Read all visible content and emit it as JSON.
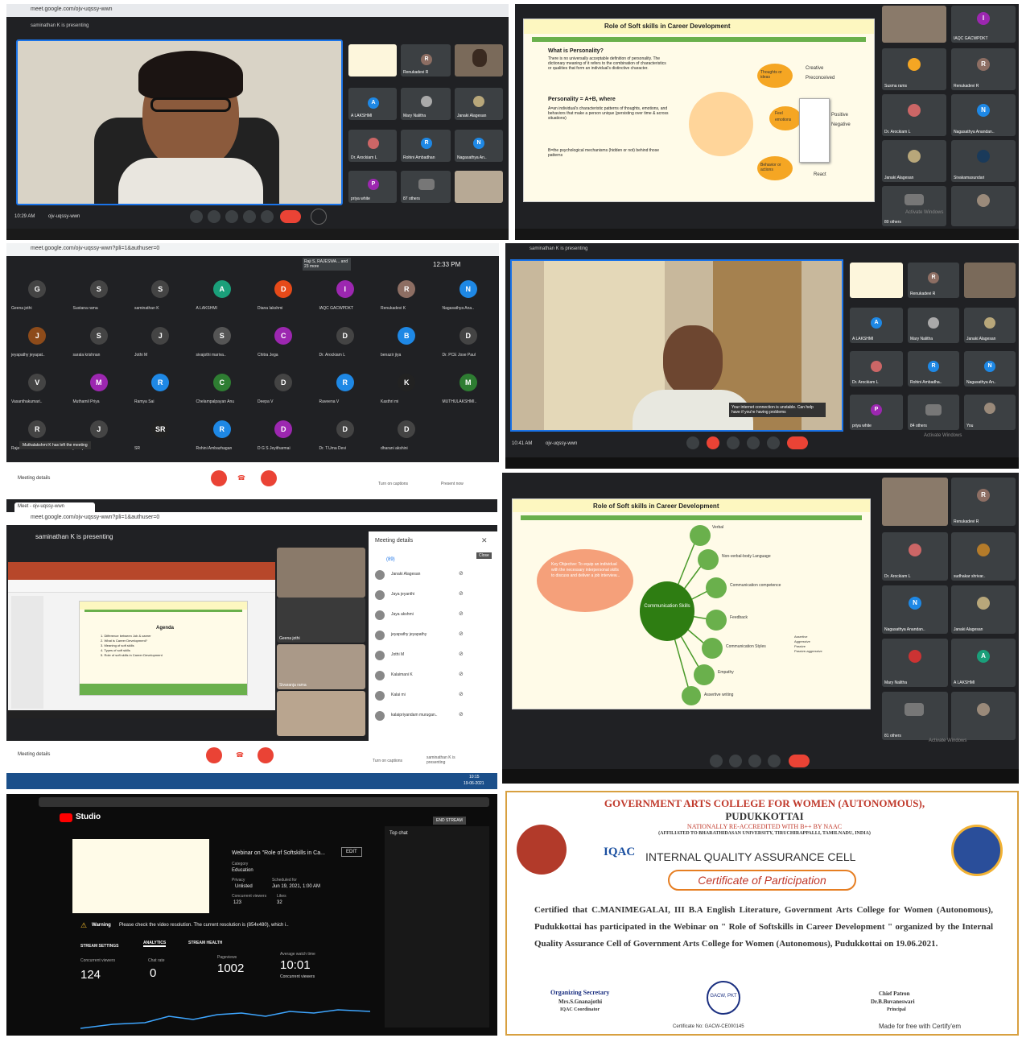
{
  "p1": {
    "presenting": "saminathan K is presenting",
    "time": "10:29 AM",
    "code": "ojv-uqssy-wwn",
    "tiles": [
      "Renukadevi R",
      "A LAKSHMI",
      "Mary Nalitha",
      "Janaki Alagesan",
      "Dr. Arockiam L",
      "Rohini Ambadhan",
      "Nagasathya An..",
      "priya white",
      "87 others"
    ]
  },
  "p2": {
    "title": "Role of Soft skills in Career Development",
    "h1": "What is Personality?",
    "body1": "There is no universally acceptable definition of personality. The dictionary meaning of it refers to the combination of characteristics or qualities that form an individual's distinctive character.",
    "h2": "Personality = A+B, where",
    "body2": "A=an individual's characteristic patterns of thoughts, emotions, and behaviors that make a person unique (persisting over time & across situations)",
    "body3": "B=the psychological mechanisms (hidden or not) behind those patterns",
    "thoughts": "Thoughts or ideas",
    "creative": "Creative",
    "preconceived": "Preconceived",
    "feel": "Feel",
    "emot": "emotions",
    "positive": "Positive",
    "negative": "Negative",
    "behavior": "Behavior or actions",
    "react": "React",
    "tiles": [
      "IAQC GACWPDKT",
      "Susma rams",
      "Renukadevi R",
      "Dr. Arockiam L",
      "Nagasathya Anandan..",
      "Janaki Alagesan",
      "Sivakamasundari",
      "80 others"
    ],
    "activate": "Activate Windows",
    "settings": "Go to Settings to activate Windows."
  },
  "p3": {
    "url": "meet.google.com/ojv-uqssy-wwn?pli=1&authuser=0",
    "joined": "Raji S, RAJESWA... and 23 more",
    "time": "12:33 PM",
    "details": "Meeting details",
    "captions": "Turn on captions",
    "present": "Present now",
    "left": "Muthalakshmi K has left the meeting",
    "people": [
      [
        "Geena jothi",
        "#444"
      ],
      [
        "Sustana rama",
        "#444"
      ],
      [
        "saminathan K",
        "#444"
      ],
      [
        "A LAKSHMI",
        "#1a9f7a"
      ],
      [
        "Diana lakshmi",
        "#e64a19"
      ],
      [
        "IAQC GACWPDKT",
        "#9c27b0"
      ],
      [
        "Renukadevi K",
        "#8d6e63"
      ],
      [
        "Nagasathya Ana..",
        "#1e88e5"
      ],
      [
        "jeyapathy jeyapat..",
        "#8d4b1a"
      ],
      [
        "sarala krishnan",
        "#444"
      ],
      [
        "Jothi M",
        "#444"
      ],
      [
        "sivajothi mariva..",
        "#555"
      ],
      [
        "Chitra Jega",
        "#9c27b0"
      ],
      [
        "Dr. Arockiam L",
        "#444"
      ],
      [
        "benazir jiya",
        "#1e88e5"
      ],
      [
        "Dr. PCE Jose Paul",
        "#444"
      ],
      [
        "Vasanthakumari..",
        "#444"
      ],
      [
        "Muthamil Priya",
        "#9c27b0"
      ],
      [
        "Ramya Sai",
        "#1e88e5"
      ],
      [
        "Chelampalpayan Anu",
        "#2e7d32"
      ],
      [
        "Deepa V",
        "#444"
      ],
      [
        "Raveena V",
        "#1e88e5"
      ],
      [
        "Kasthri mi",
        "#222"
      ],
      [
        "MUTHULAKSHMI..",
        "#2e7d32"
      ],
      [
        "Rajeswari Lakshmi",
        "#444"
      ],
      [
        "jai vejatha",
        "#444"
      ],
      [
        "SR",
        "#222"
      ],
      [
        "Rohini Ambazhagan",
        "#1e88e5"
      ],
      [
        "D G S Jeyitharmai",
        "#9c27b0"
      ],
      [
        "Dr. T.Uma Devi",
        "#444"
      ],
      [
        "dharani akshini",
        "#444"
      ]
    ]
  },
  "p4": {
    "presenting": "saminathan K is presenting",
    "time": "10:41 AM",
    "code": "ojv-uqssy-wwn",
    "warning": "Your internet connection is unstable. Can help have if you're having problems",
    "tiles": [
      "Renukadevi R",
      "A LAKSHMI",
      "Mary Nalitha",
      "Janaki Alagesan",
      "Dr. Arockiam L",
      "Rohini Ambadha..",
      "Nagasathya An..",
      "priya white",
      "84 others",
      "You"
    ],
    "activate": "Activate Windows"
  },
  "p5": {
    "tab": "Meet - ojv-uqssy-wwn",
    "url": "meet.google.com/ojv-uqssy-wwn?pli=1&authuser=0",
    "presenting": "saminathan K is presenting",
    "agenda": "Agenda",
    "items": [
      "1. Difference between Job & career",
      "2. What is Career Development?",
      "3. Meaning of soft skills",
      "4. Types of soft skills",
      "5. Role of soft skills in Career Development"
    ],
    "details_title": "Meeting details",
    "close": "Close",
    "count": "(89)",
    "people": [
      "Janaki Alagesan",
      "Jaya jeyanthi",
      "Jaya akshmi",
      "jeyapathy jeyapathy",
      "Jothi M",
      "Kalaimani K",
      "Kalai mi",
      "kalaipriyandam murugan.."
    ],
    "tiles": [
      "",
      "Geena jothi",
      "Sivaranja rama",
      ""
    ],
    "details": "Meeting details",
    "captions": "Turn on captions",
    "presenting2": "saminathan K is presenting",
    "clock": "10:15",
    "date": "19-06-2021"
  },
  "p6": {
    "title": "Role of Soft skills in Career Development",
    "key": "Key Objective: To equip an individual with the necessary interpersonal skills to discuss and deliver a job interview...",
    "center": "Communication Skills",
    "branches": [
      "Verbal",
      "Non-verbal-body Language",
      "Communication competence",
      "Feedback",
      "Communication Styles",
      "Empathy",
      "Assertive writing"
    ],
    "styles": [
      "Assertive",
      "Aggressive",
      "Passive",
      "Passive-aggressive"
    ],
    "tiles": [
      "Renukadevi R",
      "Dr. Arockiam L",
      "sudhakar shrivar..",
      "Nagasathya Anandan..",
      "Janaki Alagesan",
      "Mary Nalitha",
      "A LAKSHMI",
      "81 others"
    ],
    "activate": "Activate Windows"
  },
  "p7": {
    "studio": "Studio",
    "stream_title": "Webinar on \"Role of Softskills in Ca...",
    "edit": "EDIT",
    "category_label": "Category",
    "category": "Education",
    "privacy_label": "Privacy",
    "privacy": "Unlisted",
    "sched_label": "Scheduled for",
    "sched": "Jun 19, 2021, 1:00 AM",
    "viewers_label": "Concurrent viewers",
    "viewers_small": "123",
    "likes_label": "Likes",
    "likes": "32",
    "warning_label": "Warning",
    "warning": "Please check the video resolution. The current resolution is (854x480), which i..",
    "tabs": [
      "STREAM SETTINGS",
      "ANALYTICS",
      "STREAM HEALTH"
    ],
    "m1_label": "Concurrent viewers",
    "m1": "124",
    "m2_label": "Chat rate",
    "m2": "0",
    "m3_label": "Pageviews",
    "m3": "1002",
    "m4_label": "Average watch time",
    "m4": "10:01",
    "m4_sub": "Concurrent viewers",
    "chat_title": "Top chat",
    "end": "END STREAM"
  },
  "cert": {
    "college": "GOVERNMENT ARTS COLLEGE FOR WOMEN (AUTONOMOUS),",
    "town": "PUDUKKOTTAI",
    "naac": "NATIONALLY RE-ACCREDITED WITH B++ BY NAAC",
    "affil": "(AFFILIATED TO BHARATHIDASAN UNIVERSITY, TIRUCHIRAPPALLI, TAMILNADU, INDIA)",
    "iqac_logo": "IQAC",
    "cell": "INTERNAL QUALITY ASSURANCE CELL",
    "cop": "Certificate of Participation",
    "body": "Certified that C.MANIMEGALAI, III B.A English Literature, Government Arts College for Women (Autonomous), Pudukkottai has participated in the Webinar on \" Role of Softskills in Career Development \" organized by the Internal Quality Assurance Cell of Government Arts College for Women (Autonomous), Pudukkottai on 19.06.2021.",
    "sig1_title": "Organizing Secretary",
    "sig1_name": "Mrs.S.Gnanajothi",
    "sig1_role": "IQAC Coordinator",
    "sig2_title": "Chief Patron",
    "sig2_name": "Dr.B.Buvaneswari",
    "sig2_role": "Principal",
    "seal": "GACW, PKT",
    "cert_no": "Certificate No: GACW-CE000145",
    "footer": "Made for free with Certify'em"
  }
}
